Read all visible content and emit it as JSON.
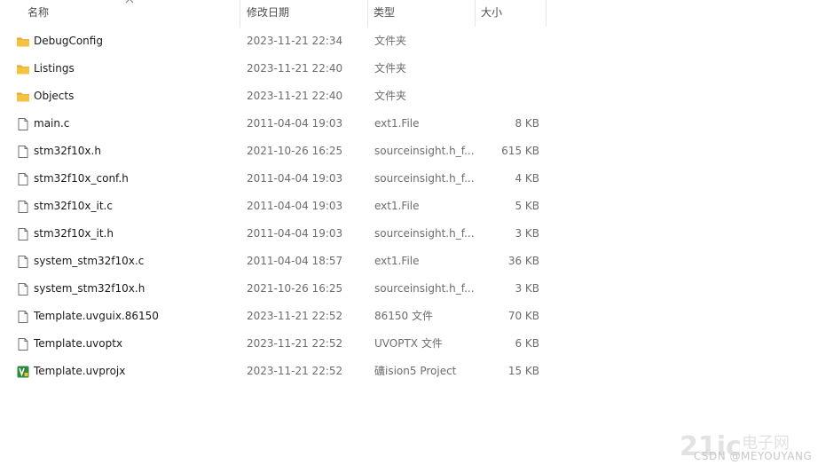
{
  "columns": {
    "name": "名称",
    "date": "修改日期",
    "type": "类型",
    "size": "大小"
  },
  "files": [
    {
      "name": "DebugConfig",
      "date": "2023-11-21 22:34",
      "type": "文件夹",
      "size": "",
      "icon": "folder-icon"
    },
    {
      "name": "Listings",
      "date": "2023-11-21 22:40",
      "type": "文件夹",
      "size": "",
      "icon": "folder-icon"
    },
    {
      "name": "Objects",
      "date": "2023-11-21 22:40",
      "type": "文件夹",
      "size": "",
      "icon": "folder-icon"
    },
    {
      "name": "main.c",
      "date": "2011-04-04 19:03",
      "type": "ext1.File",
      "size": "8 KB",
      "icon": "file-icon"
    },
    {
      "name": "stm32f10x.h",
      "date": "2021-10-26 16:25",
      "type": "sourceinsight.h_f...",
      "size": "615 KB",
      "icon": "file-icon"
    },
    {
      "name": "stm32f10x_conf.h",
      "date": "2011-04-04 19:03",
      "type": "sourceinsight.h_f...",
      "size": "4 KB",
      "icon": "file-icon"
    },
    {
      "name": "stm32f10x_it.c",
      "date": "2011-04-04 19:03",
      "type": "ext1.File",
      "size": "5 KB",
      "icon": "file-icon"
    },
    {
      "name": "stm32f10x_it.h",
      "date": "2011-04-04 19:03",
      "type": "sourceinsight.h_f...",
      "size": "3 KB",
      "icon": "file-icon"
    },
    {
      "name": "system_stm32f10x.c",
      "date": "2011-04-04 18:57",
      "type": "ext1.File",
      "size": "36 KB",
      "icon": "file-icon"
    },
    {
      "name": "system_stm32f10x.h",
      "date": "2021-10-26 16:25",
      "type": "sourceinsight.h_f...",
      "size": "3 KB",
      "icon": "file-icon"
    },
    {
      "name": "Template.uvguix.86150",
      "date": "2023-11-21 22:52",
      "type": "86150 文件",
      "size": "70 KB",
      "icon": "file-icon"
    },
    {
      "name": "Template.uvoptx",
      "date": "2023-11-21 22:52",
      "type": "UVOPTX 文件",
      "size": "6 KB",
      "icon": "file-icon"
    },
    {
      "name": "Template.uvprojx",
      "date": "2023-11-21 22:52",
      "type": "礦ision5 Project",
      "size": "15 KB",
      "icon": "uvision-project-icon"
    }
  ],
  "watermark": {
    "logo": "21ic",
    "site": "电子网",
    "text": "CSDN @MEYOUYANG"
  },
  "colors": {
    "folder": "#f5c242",
    "folder_dark": "#e0a82e",
    "uvision": "#2e8b3a"
  }
}
